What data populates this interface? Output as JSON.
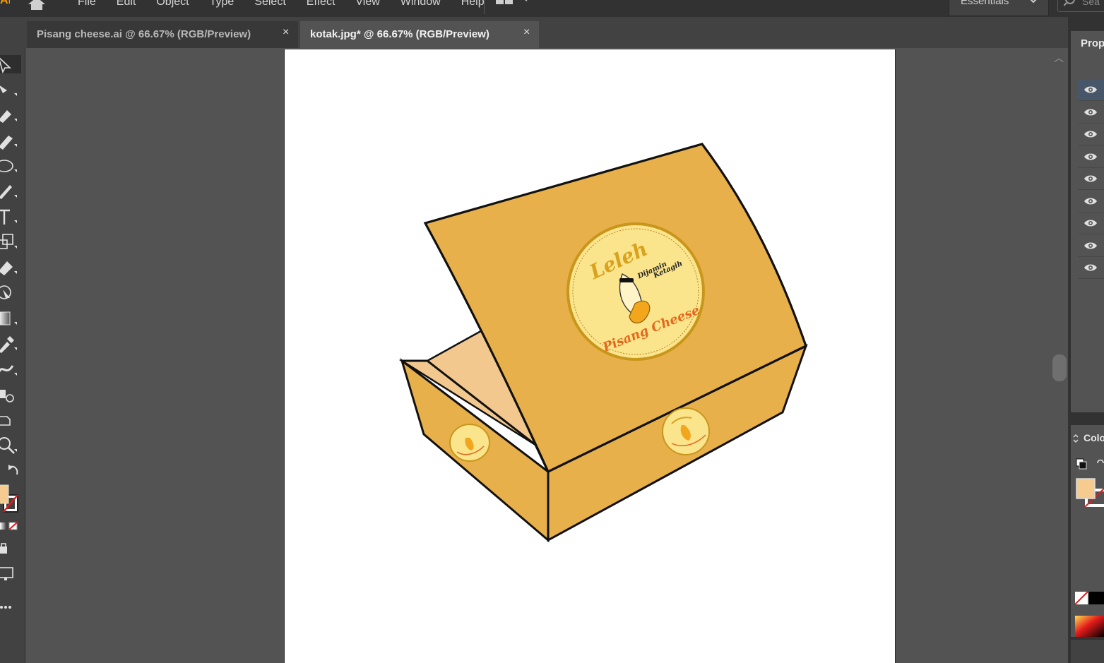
{
  "app": {
    "logo": "Ai"
  },
  "menu": [
    "File",
    "Edit",
    "Object",
    "Type",
    "Select",
    "Effect",
    "View",
    "Window",
    "Help"
  ],
  "workspace": {
    "label": "Essentials",
    "search_placeholder": "Sea"
  },
  "tabs": [
    {
      "label": "Pisang cheese.ai @ 66.67% (RGB/Preview)",
      "close": "×",
      "active": false
    },
    {
      "label": "kotak.jpg* @ 66.67% (RGB/Preview)",
      "close": "×",
      "active": true
    }
  ],
  "artwork": {
    "box_color": "#e8b04a",
    "box_inner_color": "#f2c88e",
    "badge_color": "#fae48c",
    "brand_top": "Leleh",
    "brand_slogan_1": "Dijamin",
    "brand_slogan_2": "Ketagih",
    "brand_bottom": "Pisang Cheese"
  },
  "panels": {
    "properties_title": "Prop",
    "color_title": "Colo",
    "layer_count": 9,
    "fill_color": "#f5cb8f"
  },
  "tools": [
    "selection-tool",
    "direct-selection-tool",
    "pen-tool",
    "pencil-tool",
    "ellipse-tool",
    "paintbrush-tool",
    "type-tool",
    "scale-tool",
    "eraser-tool",
    "puppet-warp-tool",
    "gradient-tool",
    "eyedropper-tool",
    "blend-tool",
    "symbol-sprayer-tool",
    "artboard-tool",
    "zoom-tool"
  ]
}
